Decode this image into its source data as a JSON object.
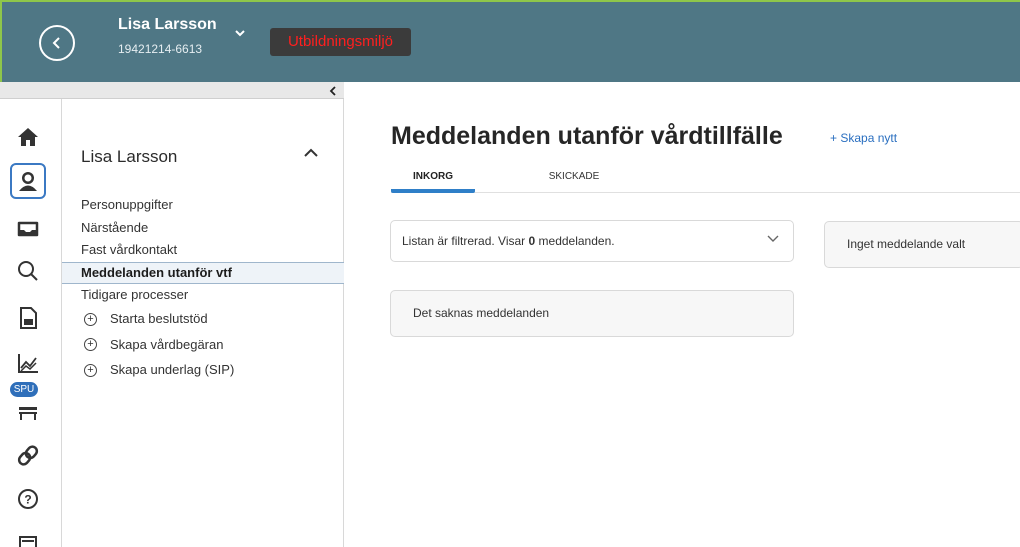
{
  "header": {
    "patient_name": "Lisa Larsson",
    "patient_id": "19421214-6613",
    "environment_badge": "Utbildningsmiljö",
    "back_icon": "chevron-left-circle-icon",
    "accent_color": "#4f7785",
    "environment_color": "#ff1f1f"
  },
  "sidebar": {
    "collapse_icon": "chevron-left-icon",
    "rail": [
      {
        "name": "home-icon"
      },
      {
        "name": "patient-icon",
        "active": true
      },
      {
        "name": "inbox-tray-icon"
      },
      {
        "name": "search-icon"
      },
      {
        "name": "document-icon"
      },
      {
        "name": "chart-icon"
      },
      {
        "name": "bed-icon",
        "badge": "SPU"
      },
      {
        "name": "link-icon"
      },
      {
        "name": "help-icon"
      },
      {
        "name": "screen-icon"
      }
    ],
    "spu_badge": "SPU"
  },
  "patient_panel": {
    "title": "Lisa Larsson",
    "items": [
      {
        "label": "Personuppgifter"
      },
      {
        "label": "Närstående"
      },
      {
        "label": "Fast vårdkontakt"
      },
      {
        "label": "Meddelanden utanför vtf",
        "active": true
      },
      {
        "label": "Tidigare processer"
      }
    ],
    "actions": [
      {
        "label": "Starta beslutstöd"
      },
      {
        "label": "Skapa vårdbegäran"
      },
      {
        "label": "Skapa underlag (SIP)"
      }
    ]
  },
  "main": {
    "title": "Meddelanden utanför vårdtillfälle",
    "create_label": "+ Skapa nytt",
    "tabs": [
      {
        "label": "INKORG",
        "active": true
      },
      {
        "label": "SKICKADE"
      }
    ],
    "filter": {
      "prefix": "Listan är filtrerad. Visar ",
      "count": "0",
      "suffix": " meddelanden."
    },
    "empty_message": "Det saknas meddelanden",
    "detail_placeholder": "Inget meddelande valt"
  }
}
